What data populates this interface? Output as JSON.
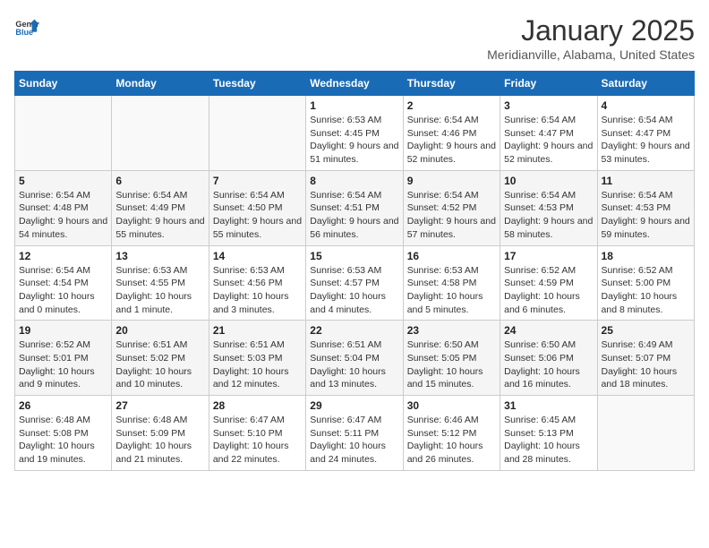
{
  "logo": {
    "line1": "General",
    "line2": "Blue"
  },
  "title": "January 2025",
  "subtitle": "Meridianville, Alabama, United States",
  "weekdays": [
    "Sunday",
    "Monday",
    "Tuesday",
    "Wednesday",
    "Thursday",
    "Friday",
    "Saturday"
  ],
  "weeks": [
    [
      {
        "day": "",
        "info": ""
      },
      {
        "day": "",
        "info": ""
      },
      {
        "day": "",
        "info": ""
      },
      {
        "day": "1",
        "info": "Sunrise: 6:53 AM\nSunset: 4:45 PM\nDaylight: 9 hours and 51 minutes."
      },
      {
        "day": "2",
        "info": "Sunrise: 6:54 AM\nSunset: 4:46 PM\nDaylight: 9 hours and 52 minutes."
      },
      {
        "day": "3",
        "info": "Sunrise: 6:54 AM\nSunset: 4:47 PM\nDaylight: 9 hours and 52 minutes."
      },
      {
        "day": "4",
        "info": "Sunrise: 6:54 AM\nSunset: 4:47 PM\nDaylight: 9 hours and 53 minutes."
      }
    ],
    [
      {
        "day": "5",
        "info": "Sunrise: 6:54 AM\nSunset: 4:48 PM\nDaylight: 9 hours and 54 minutes."
      },
      {
        "day": "6",
        "info": "Sunrise: 6:54 AM\nSunset: 4:49 PM\nDaylight: 9 hours and 55 minutes."
      },
      {
        "day": "7",
        "info": "Sunrise: 6:54 AM\nSunset: 4:50 PM\nDaylight: 9 hours and 55 minutes."
      },
      {
        "day": "8",
        "info": "Sunrise: 6:54 AM\nSunset: 4:51 PM\nDaylight: 9 hours and 56 minutes."
      },
      {
        "day": "9",
        "info": "Sunrise: 6:54 AM\nSunset: 4:52 PM\nDaylight: 9 hours and 57 minutes."
      },
      {
        "day": "10",
        "info": "Sunrise: 6:54 AM\nSunset: 4:53 PM\nDaylight: 9 hours and 58 minutes."
      },
      {
        "day": "11",
        "info": "Sunrise: 6:54 AM\nSunset: 4:53 PM\nDaylight: 9 hours and 59 minutes."
      }
    ],
    [
      {
        "day": "12",
        "info": "Sunrise: 6:54 AM\nSunset: 4:54 PM\nDaylight: 10 hours and 0 minutes."
      },
      {
        "day": "13",
        "info": "Sunrise: 6:53 AM\nSunset: 4:55 PM\nDaylight: 10 hours and 1 minute."
      },
      {
        "day": "14",
        "info": "Sunrise: 6:53 AM\nSunset: 4:56 PM\nDaylight: 10 hours and 3 minutes."
      },
      {
        "day": "15",
        "info": "Sunrise: 6:53 AM\nSunset: 4:57 PM\nDaylight: 10 hours and 4 minutes."
      },
      {
        "day": "16",
        "info": "Sunrise: 6:53 AM\nSunset: 4:58 PM\nDaylight: 10 hours and 5 minutes."
      },
      {
        "day": "17",
        "info": "Sunrise: 6:52 AM\nSunset: 4:59 PM\nDaylight: 10 hours and 6 minutes."
      },
      {
        "day": "18",
        "info": "Sunrise: 6:52 AM\nSunset: 5:00 PM\nDaylight: 10 hours and 8 minutes."
      }
    ],
    [
      {
        "day": "19",
        "info": "Sunrise: 6:52 AM\nSunset: 5:01 PM\nDaylight: 10 hours and 9 minutes."
      },
      {
        "day": "20",
        "info": "Sunrise: 6:51 AM\nSunset: 5:02 PM\nDaylight: 10 hours and 10 minutes."
      },
      {
        "day": "21",
        "info": "Sunrise: 6:51 AM\nSunset: 5:03 PM\nDaylight: 10 hours and 12 minutes."
      },
      {
        "day": "22",
        "info": "Sunrise: 6:51 AM\nSunset: 5:04 PM\nDaylight: 10 hours and 13 minutes."
      },
      {
        "day": "23",
        "info": "Sunrise: 6:50 AM\nSunset: 5:05 PM\nDaylight: 10 hours and 15 minutes."
      },
      {
        "day": "24",
        "info": "Sunrise: 6:50 AM\nSunset: 5:06 PM\nDaylight: 10 hours and 16 minutes."
      },
      {
        "day": "25",
        "info": "Sunrise: 6:49 AM\nSunset: 5:07 PM\nDaylight: 10 hours and 18 minutes."
      }
    ],
    [
      {
        "day": "26",
        "info": "Sunrise: 6:48 AM\nSunset: 5:08 PM\nDaylight: 10 hours and 19 minutes."
      },
      {
        "day": "27",
        "info": "Sunrise: 6:48 AM\nSunset: 5:09 PM\nDaylight: 10 hours and 21 minutes."
      },
      {
        "day": "28",
        "info": "Sunrise: 6:47 AM\nSunset: 5:10 PM\nDaylight: 10 hours and 22 minutes."
      },
      {
        "day": "29",
        "info": "Sunrise: 6:47 AM\nSunset: 5:11 PM\nDaylight: 10 hours and 24 minutes."
      },
      {
        "day": "30",
        "info": "Sunrise: 6:46 AM\nSunset: 5:12 PM\nDaylight: 10 hours and 26 minutes."
      },
      {
        "day": "31",
        "info": "Sunrise: 6:45 AM\nSunset: 5:13 PM\nDaylight: 10 hours and 28 minutes."
      },
      {
        "day": "",
        "info": ""
      }
    ]
  ]
}
